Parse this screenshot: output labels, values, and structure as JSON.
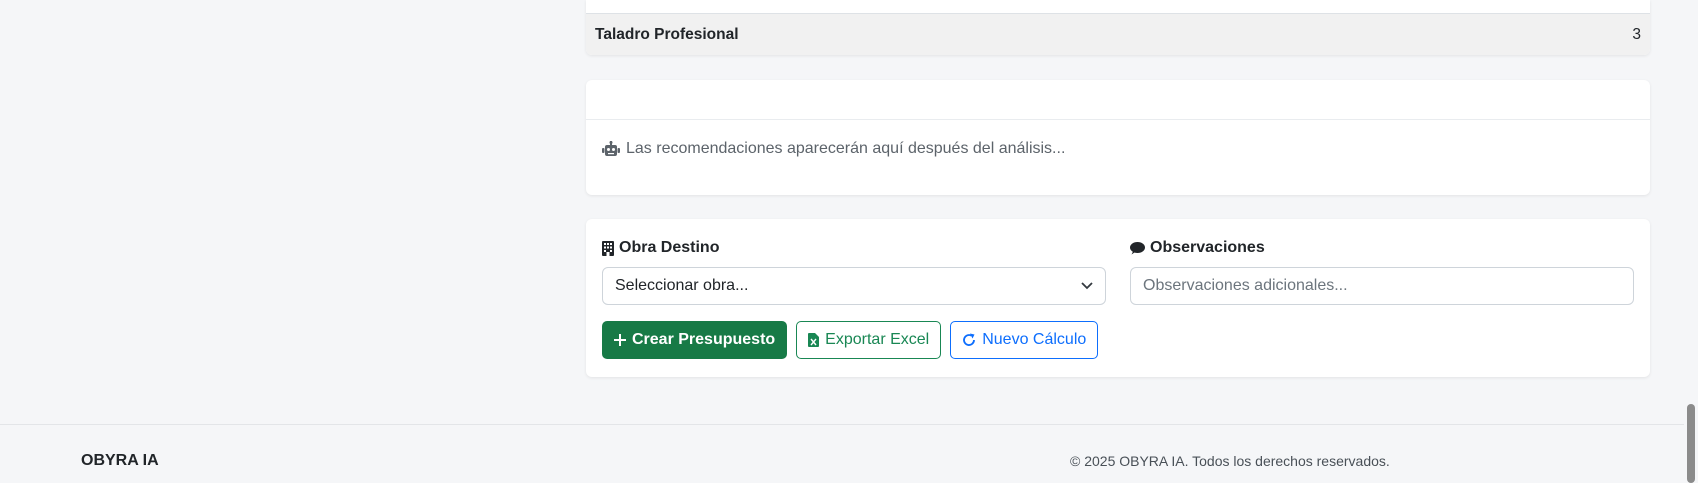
{
  "equipment": {
    "name": "Taladro Profesional",
    "quantity": "3"
  },
  "recommendations": {
    "icon": "robot-icon",
    "placeholder_text": "Las recomendaciones aparecerán aquí después del análisis..."
  },
  "form": {
    "obra_label": "Obra Destino",
    "obra_icon": "building-icon",
    "obra_selected": "Seleccionar obra...",
    "observaciones_label": "Observaciones",
    "observaciones_icon": "comment-icon",
    "observaciones_placeholder": "Observaciones adicionales..."
  },
  "actions": {
    "create_label": "Crear Presupuesto",
    "export_label": "Exportar Excel",
    "new_label": "Nuevo Cálculo"
  },
  "footer": {
    "brand": "OBYRA IA",
    "copyright": "© 2025 OBYRA IA. Todos los derechos reservados."
  },
  "colors": {
    "primary_green": "#177a46",
    "outline_green": "#198754",
    "outline_blue": "#0d6efd",
    "page_bg": "#f5f6f8"
  }
}
